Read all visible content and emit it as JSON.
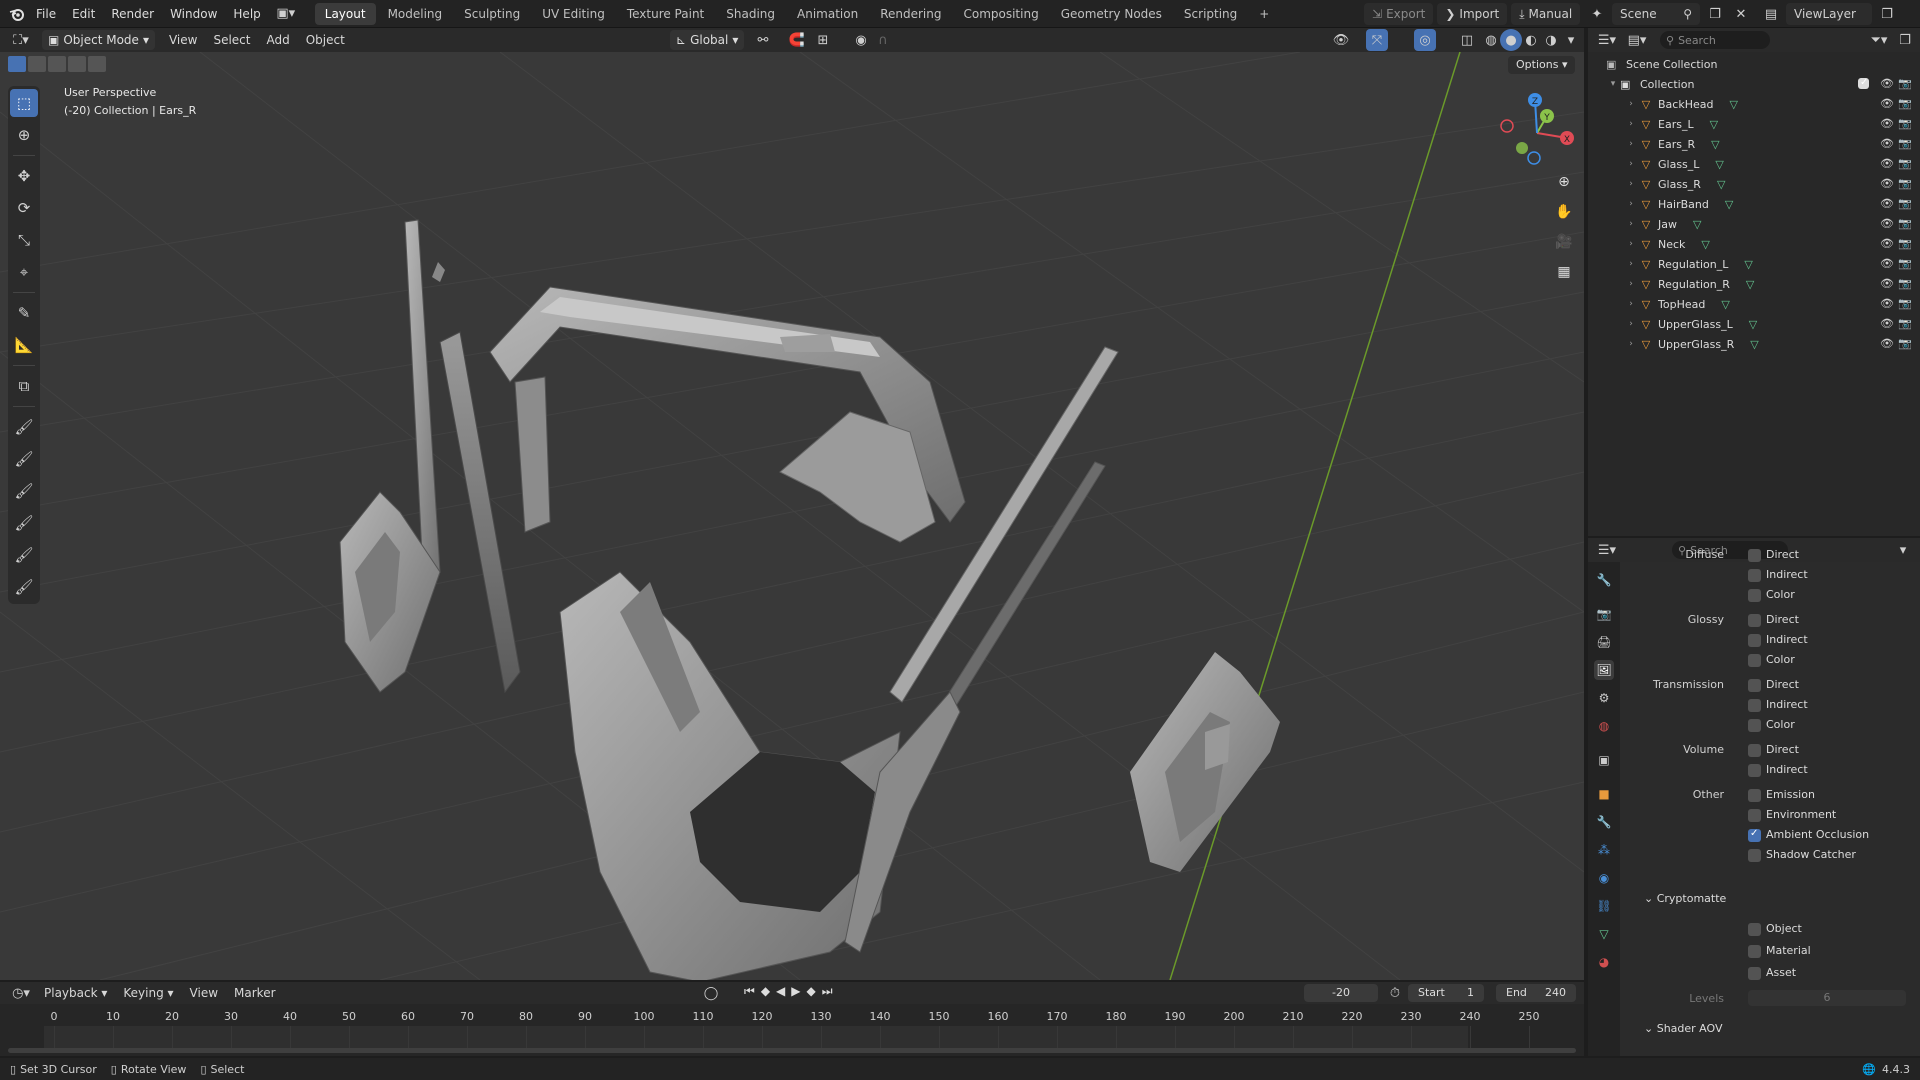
{
  "topbar": {
    "menus": [
      "File",
      "Edit",
      "Render",
      "Window",
      "Help"
    ],
    "workspaces": [
      "Layout",
      "Modeling",
      "Sculpting",
      "UV Editing",
      "Texture Paint",
      "Shading",
      "Animation",
      "Rendering",
      "Compositing",
      "Geometry Nodes",
      "Scripting"
    ],
    "active_workspace": "Layout",
    "add_workspace": "+",
    "export_label": "Export",
    "import_label": "Import",
    "manual_label": "Manual",
    "scene_label": "Scene",
    "viewlayer_label": "ViewLayer"
  },
  "viewport_header": {
    "mode": "Object Mode",
    "menus": [
      "View",
      "Select",
      "Add",
      "Object"
    ],
    "orientation": "Global",
    "options_label": "Options"
  },
  "viewport": {
    "perspective_label": "User Perspective",
    "context_label": "(-20) Collection | Ears_R",
    "gizmo": {
      "x": "X",
      "y": "Y",
      "z": "Z"
    }
  },
  "outliner": {
    "search_placeholder": "Search",
    "scene_collection": "Scene Collection",
    "collection": "Collection",
    "objects": [
      "BackHead",
      "Ears_L",
      "Ears_R",
      "Glass_L",
      "Glass_R",
      "HairBand",
      "Jaw",
      "Neck",
      "Regulation_L",
      "Regulation_R",
      "TopHead",
      "UpperGlass_L",
      "UpperGlass_R"
    ],
    "active_object": "Ears_R"
  },
  "properties": {
    "search_placeholder": "Search",
    "groups": [
      {
        "label": "Diffuse",
        "items": [
          {
            "label": "Direct",
            "checked": false
          },
          {
            "label": "Indirect",
            "checked": false
          },
          {
            "label": "Color",
            "checked": false
          }
        ]
      },
      {
        "label": "Glossy",
        "items": [
          {
            "label": "Direct",
            "checked": false
          },
          {
            "label": "Indirect",
            "checked": false
          },
          {
            "label": "Color",
            "checked": false
          }
        ]
      },
      {
        "label": "Transmission",
        "items": [
          {
            "label": "Direct",
            "checked": false
          },
          {
            "label": "Indirect",
            "checked": false
          },
          {
            "label": "Color",
            "checked": false
          }
        ]
      },
      {
        "label": "Volume",
        "items": [
          {
            "label": "Direct",
            "checked": false
          },
          {
            "label": "Indirect",
            "checked": false
          }
        ]
      },
      {
        "label": "Other",
        "items": [
          {
            "label": "Emission",
            "checked": false
          },
          {
            "label": "Environment",
            "checked": false
          },
          {
            "label": "Ambient Occlusion",
            "checked": true
          },
          {
            "label": "Shadow Catcher",
            "checked": false
          }
        ]
      }
    ],
    "cryptomatte": {
      "title": "Cryptomatte",
      "items": [
        {
          "label": "Object",
          "checked": false
        },
        {
          "label": "Material",
          "checked": false
        },
        {
          "label": "Asset",
          "checked": false
        }
      ],
      "levels_label": "Levels",
      "levels_value": "6"
    },
    "shader_aov_title": "Shader AOV"
  },
  "timeline": {
    "menus": [
      "Playback",
      "Keying",
      "View",
      "Marker"
    ],
    "current_frame": "-20",
    "start_label": "Start",
    "start_value": "1",
    "end_label": "End",
    "end_value": "240",
    "ticks": [
      "0",
      "10",
      "20",
      "30",
      "40",
      "50",
      "60",
      "70",
      "80",
      "90",
      "100",
      "110",
      "120",
      "130",
      "140",
      "150",
      "160",
      "170",
      "180",
      "190",
      "200",
      "210",
      "220",
      "230",
      "240",
      "250"
    ]
  },
  "statusbar": {
    "hints": [
      "Set 3D Cursor",
      "Rotate View",
      "Select"
    ],
    "version": "4.4.3"
  },
  "colors": {
    "accent": "#4772b3",
    "object_icon": "#e89a3c",
    "mesh_icon": "#63c38f",
    "x_axis": "#e04b55",
    "y_axis": "#8bc34a",
    "z_axis": "#3e8ee6"
  }
}
